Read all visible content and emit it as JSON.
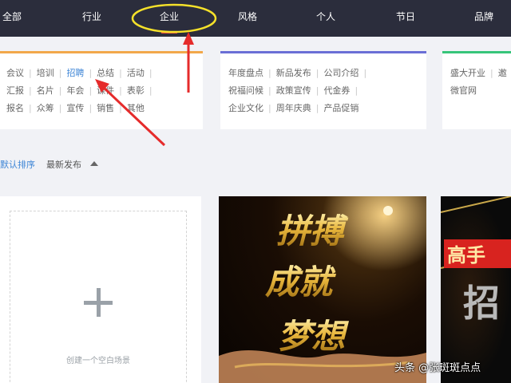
{
  "nav": {
    "items": [
      {
        "label": "全部"
      },
      {
        "label": "行业"
      },
      {
        "label": "企业"
      },
      {
        "label": "风格"
      },
      {
        "label": "个人"
      },
      {
        "label": "节日"
      },
      {
        "label": "品牌"
      }
    ],
    "active_index": 2
  },
  "panels": [
    {
      "accent": "#f2a84a",
      "rows": [
        [
          "会议",
          "培训",
          "招聘",
          "总结",
          "活动"
        ],
        [
          "汇报",
          "名片",
          "年会",
          "课件",
          "表彰"
        ],
        [
          "报名",
          "众筹",
          "宣传",
          "销售",
          "其他"
        ]
      ],
      "highlighted": "招聘"
    },
    {
      "accent": "#6a6fd6",
      "rows": [
        [
          "年度盘点",
          "新品发布",
          "公司介绍"
        ],
        [
          "祝福问候",
          "政策宣传",
          "代金券"
        ],
        [
          "企业文化",
          "周年庆典",
          "产品促销"
        ]
      ]
    },
    {
      "accent": "#37c57a",
      "rows": [
        [
          "盛大开业",
          "邀"
        ],
        [
          "微官网"
        ]
      ]
    }
  ],
  "sort": {
    "default_label": "默认排序",
    "latest_label": "最新发布"
  },
  "blank_card": {
    "label": "创建一个空白场景"
  },
  "posters": [
    {
      "title_line1": "拼搏",
      "title_line2": "成就",
      "title_line3": "梦想"
    },
    {
      "title_line1": "高手",
      "title_line2": "招"
    }
  ],
  "watermark": "头条 @张斑斑点点",
  "colors": {
    "nav_bg": "#2b2d3c",
    "link_blue": "#3f86d6",
    "annotation_red": "#e52b2b",
    "annotation_yellow": "#f5e12a"
  }
}
